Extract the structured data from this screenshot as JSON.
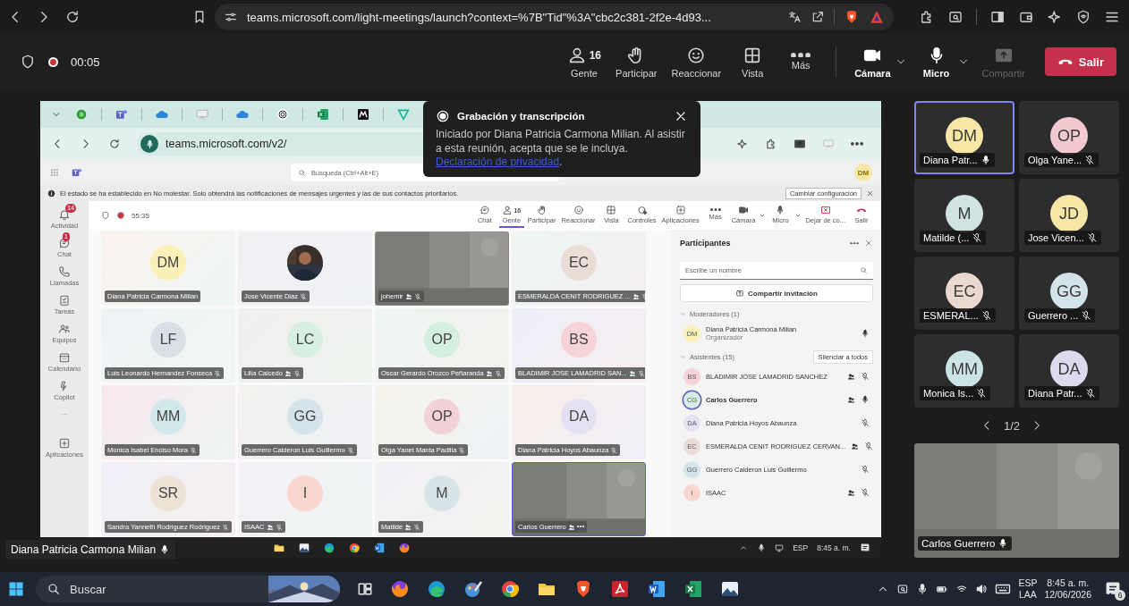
{
  "browser": {
    "address": "teams.microsoft.com/light-meetings/launch?context=%7B\"Tid\"%3A\"cbc2c381-2f2e-4d93..."
  },
  "meeting_bar": {
    "recording": true,
    "timer": "00:05",
    "buttons": [
      {
        "kind": "people",
        "label": "Gente",
        "count": "16",
        "disabled": false
      },
      {
        "kind": "hand",
        "label": "Participar",
        "disabled": false
      },
      {
        "kind": "react",
        "label": "Reaccionar",
        "disabled": false
      },
      {
        "kind": "view",
        "label": "Vista",
        "disabled": false
      },
      {
        "kind": "more",
        "label": "Más",
        "disabled": false
      },
      {
        "kind": "camera",
        "label": "Cámara",
        "disabled": false
      },
      {
        "kind": "mic",
        "label": "Micro",
        "disabled": false
      },
      {
        "kind": "share",
        "label": "Compartir",
        "disabled": true
      },
      {
        "kind": "leave",
        "label": "Salir",
        "disabled": false
      }
    ]
  },
  "shared_screen": {
    "address": "teams.microsoft.com/v2/",
    "search": {
      "placeholder": "Búsqueda (Ctrl+Alt+E)"
    },
    "user_initials": "DM",
    "notice": "El estado se ha establecido en No molestar. Solo obtendrá las notificaciones de mensajes urgentes y las de sus contactos prioritarios.",
    "notice_button": "Cambiar configuración",
    "rail": [
      {
        "kind": "bell",
        "label": "Actividad",
        "badge": "14"
      },
      {
        "kind": "chat",
        "label": "Chat",
        "badge": "1"
      },
      {
        "kind": "call",
        "label": "Llamadas"
      },
      {
        "kind": "tasks",
        "label": "Tareas"
      },
      {
        "kind": "teams",
        "label": "Equipos"
      },
      {
        "kind": "calendar",
        "label": "Calendario"
      },
      {
        "kind": "copilot",
        "label": "Copilot"
      },
      {
        "kind": "more",
        "label": "..."
      },
      {
        "kind": "apps",
        "label": "Aplicaciones"
      }
    ],
    "recording": true,
    "timer": "55:35",
    "toolbar": [
      {
        "kind": "chat",
        "label": "Chat",
        "selected": false
      },
      {
        "kind": "people",
        "label": "Gente",
        "count": "16",
        "selected": true
      },
      {
        "kind": "hand",
        "label": "Participar",
        "selected": false
      },
      {
        "kind": "react",
        "label": "Reaccionar",
        "selected": false
      },
      {
        "kind": "view",
        "label": "Vista",
        "selected": false
      },
      {
        "kind": "controls",
        "label": "Controles",
        "selected": false
      },
      {
        "kind": "apps",
        "label": "Aplicaciones",
        "selected": false
      },
      {
        "kind": "more",
        "label": "Más",
        "selected": false
      },
      {
        "kind": "camera",
        "label": "Cámara",
        "selected": false
      },
      {
        "kind": "mic",
        "label": "Micro",
        "selected": false
      },
      {
        "kind": "stop",
        "label": "Dejar de co...",
        "selected": false
      },
      {
        "kind": "leave",
        "label": "Salir",
        "selected": false
      }
    ],
    "tiles": [
      {
        "kind": "avatar",
        "initials": "DM",
        "color": "#fbf0b8",
        "name": "Diana Patricia Carmona Milian",
        "guest": false,
        "muted": false,
        "more": false,
        "selected": false
      },
      {
        "name": "Jose Vicente Diaz",
        "guest": false,
        "muted": true,
        "more": false,
        "selected": false
      },
      {
        "kind": "video",
        "name": "johemir",
        "guest": true,
        "muted": true,
        "more": false,
        "selected": false
      },
      {
        "kind": "avatar",
        "initials": "EC",
        "color": "#eaddd6",
        "name": "ESMERALDA CENIT RODRIGUEZ ...",
        "guest": true,
        "muted": true,
        "more": false,
        "selected": false
      },
      {
        "kind": "avatar",
        "initials": "LF",
        "color": "#d8e2e6",
        "name": "Luis Leonardo Hernandez Fonseca",
        "guest": false,
        "muted": true,
        "more": false,
        "selected": false
      },
      {
        "kind": "avatar",
        "initials": "LC",
        "color": "#d6efe0",
        "name": "Lilia Caicedo",
        "guest": true,
        "muted": true,
        "more": false,
        "selected": false
      },
      {
        "kind": "avatar",
        "initials": "OP",
        "color": "#d4efde",
        "name": "Oscar Gerardo Orozco Peñaranda",
        "guest": true,
        "muted": true,
        "more": false,
        "selected": false
      },
      {
        "kind": "avatar",
        "initials": "BS",
        "color": "#f6d3d6",
        "name": "BLADIMIR JOSE LAMADRID SAN...",
        "guest": true,
        "muted": true,
        "more": false,
        "selected": false
      },
      {
        "kind": "avatar",
        "initials": "MM",
        "color": "#d2e9ec",
        "name": "Monica Isabel Enciso Mora",
        "guest": false,
        "muted": true,
        "more": false,
        "selected": false
      },
      {
        "kind": "avatar",
        "initials": "GG",
        "color": "#d5e3ea",
        "name": "Guerrero Calderon Luis Guillermo",
        "guest": false,
        "muted": true,
        "more": false,
        "selected": false
      },
      {
        "kind": "avatar",
        "initials": "OP",
        "color": "#f2d2d8",
        "name": "Olga Yanet Manta Padilla",
        "guest": false,
        "muted": true,
        "more": false,
        "selected": false
      },
      {
        "kind": "avatar",
        "initials": "DA",
        "color": "#e3e1f2",
        "name": "Diana Patricia Hoyos Abaunza",
        "guest": false,
        "muted": true,
        "more": false,
        "selected": false
      },
      {
        "kind": "avatar",
        "initials": "SR",
        "color": "#eee2d6",
        "name": "Sandra Yanneth Rodriguez Rodriguez",
        "guest": false,
        "muted": true,
        "more": false,
        "selected": false
      },
      {
        "kind": "avatar",
        "initials": "I",
        "color": "#fad6cf",
        "name": "ISAAC",
        "guest": true,
        "muted": true,
        "more": false,
        "selected": false
      },
      {
        "kind": "avatar",
        "initials": "M",
        "color": "#d6e4e8",
        "name": "Matilde",
        "guest": true,
        "muted": true,
        "more": false,
        "selected": false
      },
      {
        "kind": "video",
        "name": "Carlos Guerrero",
        "guest": true,
        "muted": false,
        "more": true,
        "selected": true
      }
    ],
    "panel": {
      "title": "Participantes",
      "search": {
        "placeholder": "Escribe un nombre"
      },
      "invite": "Compartir invitación",
      "groups": [
        {
          "label": "Moderadores (1)",
          "expanded": true,
          "people": [
            {
              "initials": "DM",
              "color": "#fbf0b8",
              "name": "Diana Patricia Carmona Milian",
              "role": "Organizador",
              "guest": false,
              "muted": false,
              "highlighted": false
            }
          ]
        },
        {
          "label": "Asistentes (15)",
          "expanded": true,
          "action": "Silenciar a todos",
          "people": [
            {
              "initials": "BS",
              "color": "#f6d3d6",
              "name": "BLADIMIR JOSE LAMADRID SANCHEZ",
              "guest": true,
              "muted": true,
              "highlighted": false
            },
            {
              "initials": "CG",
              "color": "#d6efe0",
              "name": "Carlos Guerrero",
              "guest": true,
              "muted": false,
              "highlighted": true
            },
            {
              "initials": "DA",
              "color": "#e3e1f2",
              "name": "Diana Patricia Hoyos Abaunza",
              "guest": false,
              "muted": true,
              "highlighted": false
            },
            {
              "initials": "EC",
              "color": "#eaddd6",
              "name": "ESMERALDA CENIT RODRIGUEZ CERVAN...",
              "guest": true,
              "muted": true,
              "highlighted": false
            },
            {
              "initials": "GG",
              "color": "#d5e3ea",
              "name": "Guerrero Calderon Luis Guillermo",
              "guest": false,
              "muted": true,
              "highlighted": false
            },
            {
              "initials": "I",
              "color": "#fad6cf",
              "name": "ISAAC",
              "guest": true,
              "muted": true,
              "highlighted": false
            }
          ]
        }
      ]
    },
    "taskbar": {
      "language": "ESP",
      "time": "8:45 a. m."
    }
  },
  "recording_popup": {
    "title": "Grabación y transcripción",
    "text": "Iniciado por Diana Patricia Carmona Milian. Al asistir a esta reunión, acepta que se le incluya. ",
    "link": "Declaración de privacidad",
    "link_suffix": "."
  },
  "speaker_label": {
    "name": "Diana Patricia Carmona Milian",
    "muted": false
  },
  "gallery": {
    "tiles": [
      {
        "initials": "DM",
        "color": "#f6e7a6",
        "name": "Diana Patr...",
        "muted": false,
        "selected": true
      },
      {
        "initials": "OP",
        "color": "#f2c9cf",
        "name": "Olga Yane...",
        "muted": true,
        "selected": false
      },
      {
        "initials": "M",
        "color": "#cfe3e3",
        "name": "Matilde (...",
        "muted": true,
        "selected": false
      },
      {
        "initials": "JD",
        "color": "#f6e7a6",
        "name": "Jose Vicen...",
        "muted": true,
        "selected": false
      },
      {
        "initials": "EC",
        "color": "#ead9cf",
        "name": "ESMERAL...",
        "muted": true,
        "selected": false
      },
      {
        "initials": "GG",
        "color": "#d3e3ea",
        "name": "Guerrero ...",
        "muted": true,
        "selected": false
      },
      {
        "initials": "MM",
        "color": "#cde4e6",
        "name": "Monica Is...",
        "muted": true,
        "selected": false
      },
      {
        "initials": "DA",
        "color": "#ddd9ef",
        "name": "Diana Patr...",
        "muted": true,
        "selected": false
      }
    ],
    "page": "1/2",
    "spotlight": {
      "name": "Carlos Guerrero",
      "muted": false
    }
  },
  "taskbar": {
    "search": {
      "placeholder": "Buscar"
    },
    "language": "ESP",
    "layout": "LAA",
    "time": "8:45 a. m.",
    "date": "12/06/2026",
    "notifications": "6"
  }
}
